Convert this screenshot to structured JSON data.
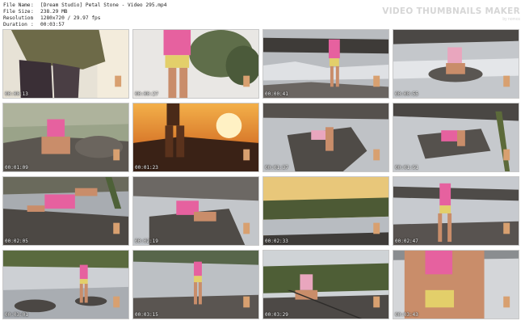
{
  "header": {
    "rows": [
      {
        "key": "File Name",
        "sep": ":",
        "value": "[Dream Studio] Petal Stone - Video 295.mp4"
      },
      {
        "key": "File Size",
        "sep": ":",
        "value": "238.29 MB"
      },
      {
        "key": "Resolution",
        "sep": ":",
        "value": "1280x720 / 29.97 fps"
      },
      {
        "key": "Duration",
        "sep": ":",
        "value": "00:03:57"
      }
    ]
  },
  "brand": {
    "title": "VIDEO THUMBNAILS MAKER",
    "subtitle": "by nomos"
  },
  "thumbnails": [
    {
      "time": "00:00:13"
    },
    {
      "time": "00:00:27"
    },
    {
      "time": "00:00:41"
    },
    {
      "time": "00:00:55"
    },
    {
      "time": "00:01:09"
    },
    {
      "time": "00:01:23"
    },
    {
      "time": "00:01:37"
    },
    {
      "time": "00:01:51"
    },
    {
      "time": "00:02:05"
    },
    {
      "time": "00:02:19"
    },
    {
      "time": "00:02:33"
    },
    {
      "time": "00:02:47"
    },
    {
      "time": "00:03:01"
    },
    {
      "time": "00:03:15"
    },
    {
      "time": "00:03:29"
    },
    {
      "time": "00:03:43"
    }
  ],
  "colors": {
    "accent_top": "#ec5aa7",
    "shorts": "#e9d864",
    "water": "#c9ccd2",
    "rock": "#4d4a47"
  }
}
